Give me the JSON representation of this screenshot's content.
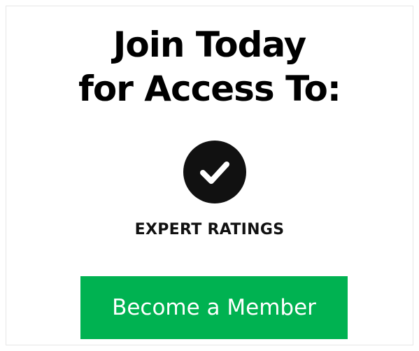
{
  "headline": {
    "line1": "Join Today",
    "line2": "for Access To:"
  },
  "feature": {
    "icon": "checkmark-circle-icon",
    "label": "EXPERT RATINGS"
  },
  "cta": {
    "label": "Become a Member"
  },
  "colors": {
    "accent": "#00b251",
    "text": "#111111",
    "border": "#e6e6e6"
  }
}
